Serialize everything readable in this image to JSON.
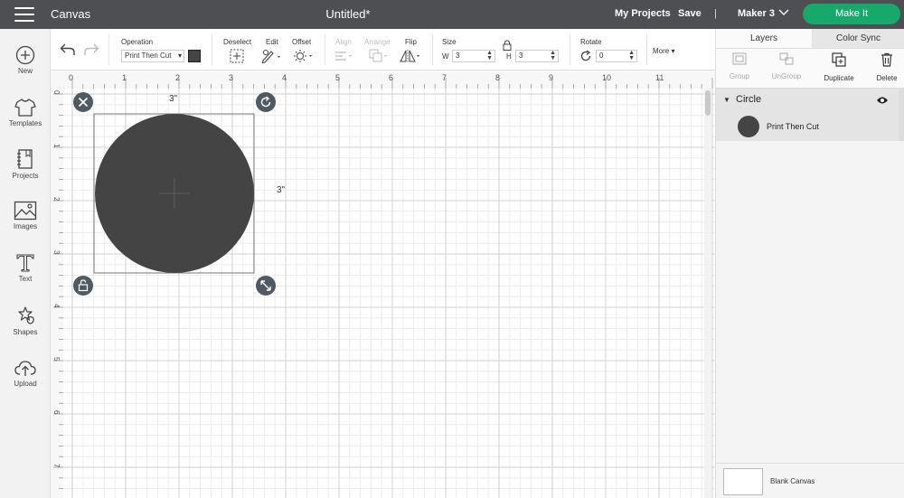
{
  "header": {
    "app_name": "Canvas",
    "doc_title": "Untitled*",
    "my_projects": "My Projects",
    "save": "Save",
    "divider": "|",
    "machine": "Maker 3",
    "make_it": "Make It"
  },
  "sidebar": {
    "items": [
      {
        "label": "New",
        "icon": "plus-circle-icon"
      },
      {
        "label": "Templates",
        "icon": "shirt-icon"
      },
      {
        "label": "Projects",
        "icon": "notebook-icon"
      },
      {
        "label": "Images",
        "icon": "image-icon"
      },
      {
        "label": "Text",
        "icon": "text-icon"
      },
      {
        "label": "Shapes",
        "icon": "shapes-icon"
      },
      {
        "label": "Upload",
        "icon": "cloud-upload-icon"
      }
    ]
  },
  "toolbar": {
    "operation_label": "Operation",
    "operation_value": "Print Then Cut",
    "operation_color": "#444444",
    "deselect": "Deselect",
    "edit": "Edit",
    "offset": "Offset",
    "align": "Align",
    "arrange": "Arrange",
    "flip": "Flip",
    "size": "Size",
    "w_label": "W",
    "w_value": "3",
    "h_label": "H",
    "h_value": "3",
    "rotate": "Rotate",
    "rotate_value": "0",
    "more": "More"
  },
  "rightpanel": {
    "tabs": [
      "Layers",
      "Color Sync"
    ],
    "actions": [
      {
        "label": "Group",
        "enabled": false
      },
      {
        "label": "UnGroup",
        "enabled": false
      },
      {
        "label": "Duplicate",
        "enabled": true
      },
      {
        "label": "Delete",
        "enabled": true
      }
    ],
    "layer": {
      "name": "Circle",
      "operation": "Print Then Cut",
      "color": "#444444"
    },
    "blank_canvas": "Blank Canvas"
  },
  "canvas": {
    "ruler_top": [
      "0",
      "1",
      "2",
      "3",
      "4",
      "5",
      "6",
      "7",
      "8",
      "9",
      "10",
      "11"
    ],
    "ruler_left": [
      "0",
      "1",
      "2",
      "3",
      "4",
      "5",
      "6",
      "7"
    ],
    "shape_color": "#444444",
    "width_label": "3\"",
    "height_label": "3\""
  }
}
